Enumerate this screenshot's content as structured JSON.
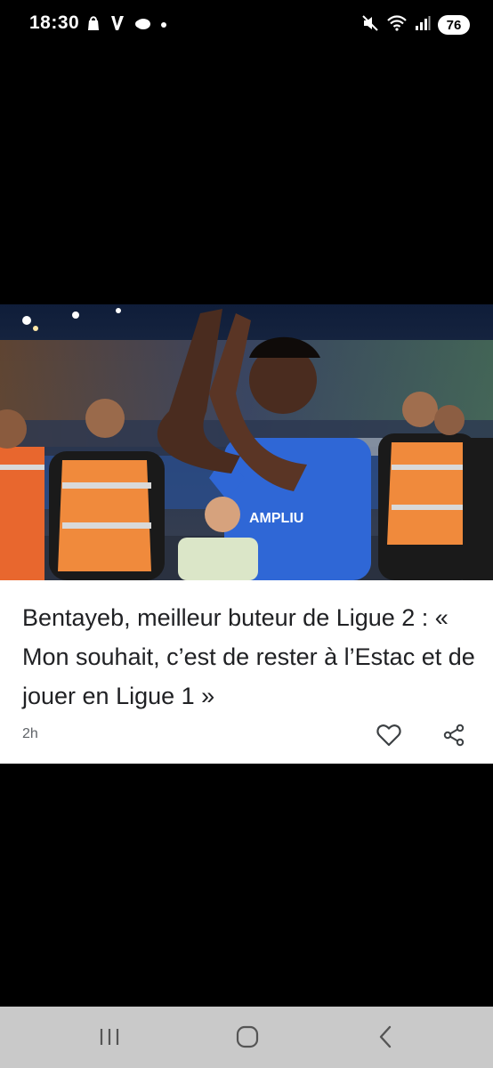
{
  "status_bar": {
    "time": "18:30",
    "left_icons": [
      "shopping-bag-icon",
      "v-app-icon",
      "weather-icon",
      "dot-icon"
    ],
    "right_icons": [
      "mute-icon",
      "wifi-icon",
      "signal-icon"
    ],
    "battery": "76"
  },
  "article": {
    "headline": "Bentayeb, meilleur buteur de Ligue 2 : « Mon souhait, c’est de rester à l’Estac et de jouer en Ligue 1 »",
    "time_ago": "2h",
    "image_icon": "football-player-photo"
  },
  "nav_bar": {
    "buttons": [
      "recent-apps-icon",
      "home-icon",
      "back-icon"
    ]
  },
  "colors": {
    "background": "#000000",
    "card": "#ffffff",
    "headline": "#202124",
    "meta": "#5f6368",
    "nav_bar": "#c9c9c9",
    "jersey_blue": "#2f67d6",
    "vest_orange": "#f08a3c"
  }
}
